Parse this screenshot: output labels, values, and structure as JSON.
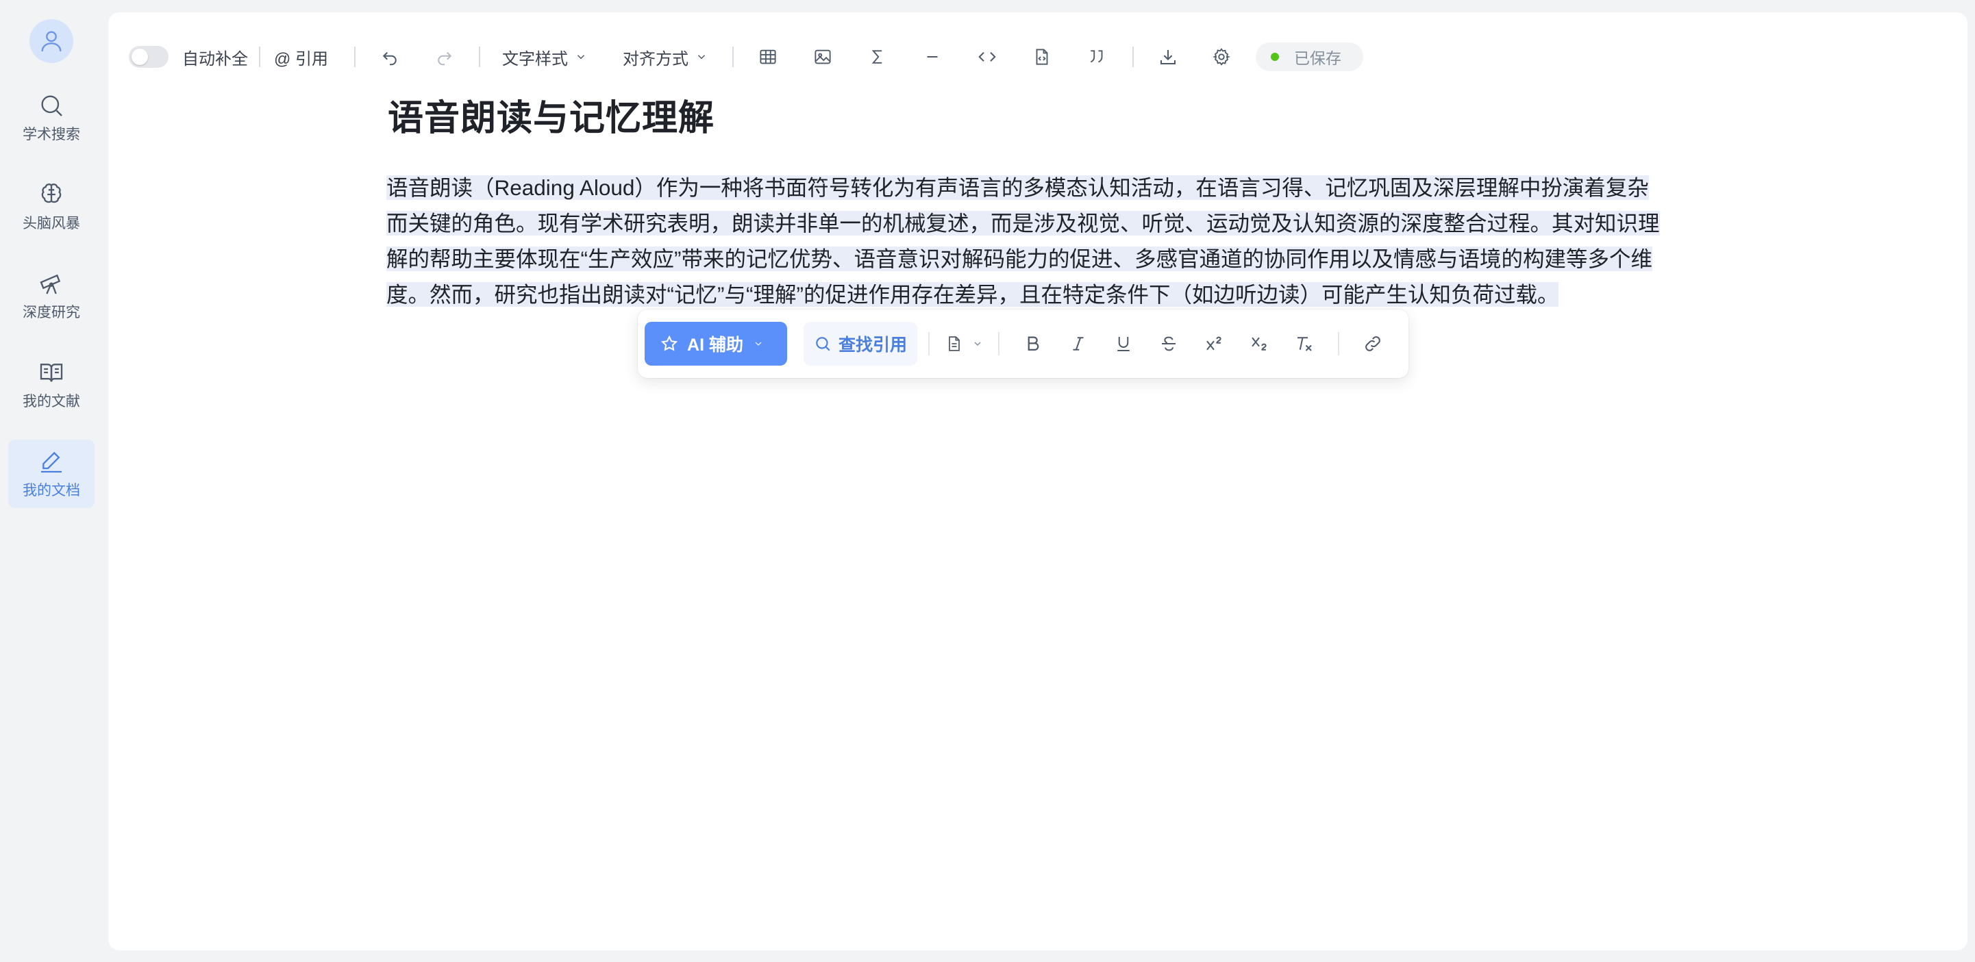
{
  "sidebar": {
    "items": [
      {
        "label": "学术搜索",
        "icon": "search-icon"
      },
      {
        "label": "头脑风暴",
        "icon": "brain-icon"
      },
      {
        "label": "深度研究",
        "icon": "telescope-icon"
      },
      {
        "label": "我的文献",
        "icon": "book-icon"
      },
      {
        "label": "我的文档",
        "icon": "pen-icon",
        "active": true
      }
    ]
  },
  "toolbar": {
    "autocomplete_label": "自动补全",
    "cite_label": "@ 引用",
    "text_style_label": "文字样式",
    "align_label": "对齐方式",
    "saved_label": "已保存",
    "autocomplete_on": false
  },
  "document": {
    "title": "语音朗读与记忆理解",
    "body": "语音朗读（Reading Aloud）作为一种将书面符号转化为有声语言的多模态认知活动，在语言习得、记忆巩固及深层理解中扮演着复杂而关键的角色。现有学术研究表明，朗读并非单一的机械复述，而是涉及视觉、听觉、运动觉及认知资源的深度整合过程。其对知识理解的帮助主要体现在“生产效应”带来的记忆优势、语音意识对解码能力的促进、多感官通道的协同作用以及情感与语境的构建等多个维度。然而，研究也指出朗读对“记忆”与“理解”的促进作用存在差异，且在特定条件下（如边听边读）可能产生认知负荷过载。"
  },
  "bubble_menu": {
    "ai_label": "AI 辅助",
    "find_citation_label": "查找引用"
  },
  "colors": {
    "accent": "#5b8ff9",
    "selection": "#e8edf8",
    "saved_dot": "#52c41a"
  }
}
